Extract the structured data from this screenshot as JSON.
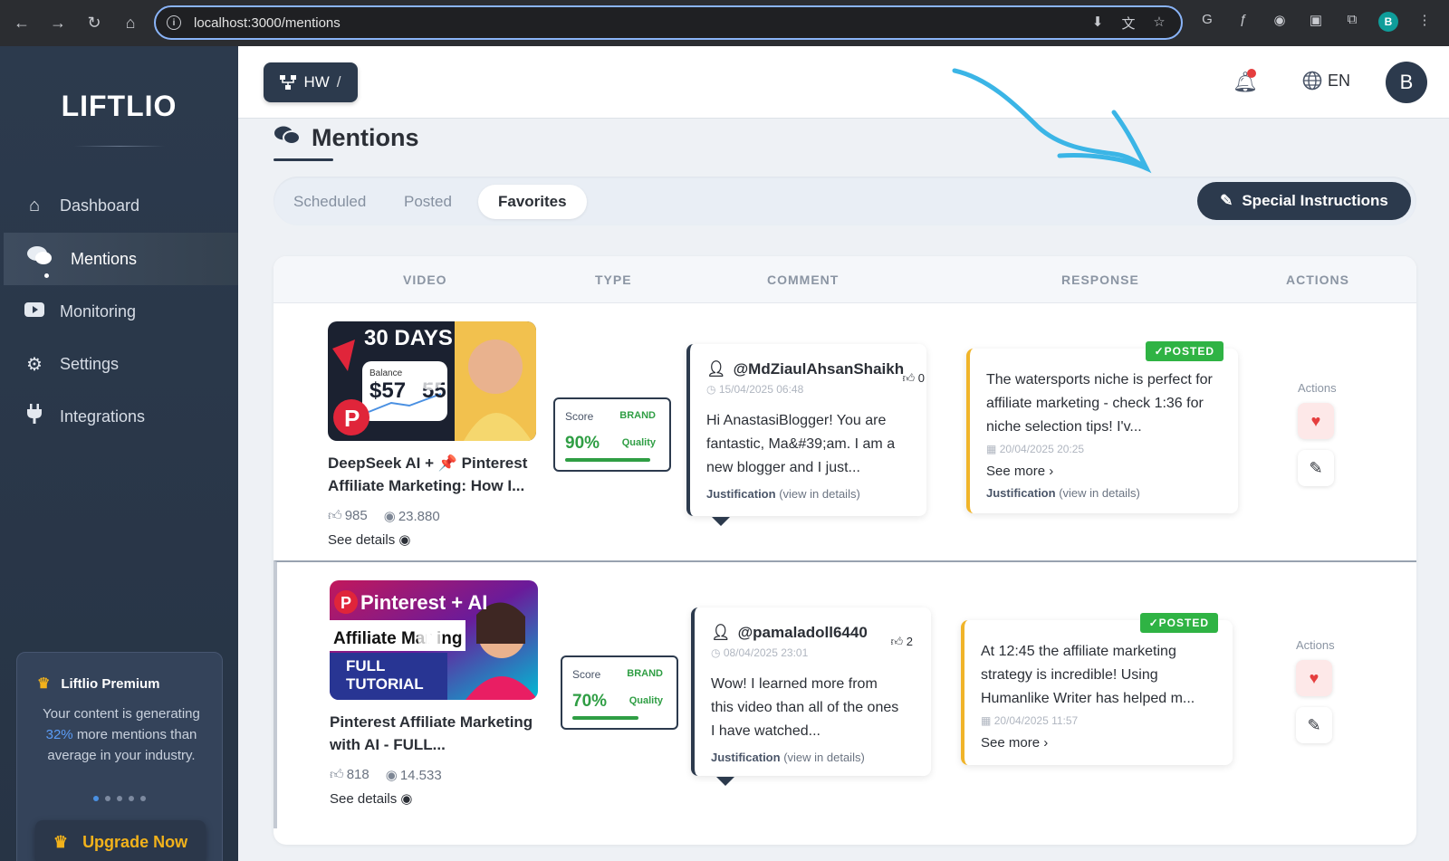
{
  "browser": {
    "url": "localhost:3000/mentions",
    "profile_initial": "B"
  },
  "sidebar": {
    "logo": "LIFTLIO",
    "items": [
      {
        "label": "Dashboard",
        "icon": "home-icon"
      },
      {
        "label": "Mentions",
        "icon": "comments-icon"
      },
      {
        "label": "Monitoring",
        "icon": "youtube-icon"
      },
      {
        "label": "Settings",
        "icon": "gear-icon"
      },
      {
        "label": "Integrations",
        "icon": "plug-icon"
      }
    ],
    "active": "Mentions",
    "premium": {
      "title": "Liftlio Premium",
      "text_before": "Your content is generating",
      "percent": "32%",
      "text_after": "more mentions than average in your industry.",
      "upgrade_label": "Upgrade Now"
    }
  },
  "header": {
    "project_label": "HW",
    "language": "EN",
    "avatar_initial": "B"
  },
  "page": {
    "title": "Mentions",
    "tabs": [
      "Scheduled",
      "Posted",
      "Favorites"
    ],
    "active_tab": "Favorites",
    "special_instructions_label": "Special Instructions"
  },
  "table": {
    "columns": [
      "VIDEO",
      "TYPE",
      "COMMENT",
      "RESPONSE",
      "ACTIONS"
    ],
    "rows": [
      {
        "video": {
          "thumb_title": "30 DAYS",
          "thumb_balance_label": "Balance",
          "thumb_amount": "$57",
          "thumb_amount_end": "55",
          "title": "DeepSeek AI + 📌 Pinterest Affiliate Marketing: How I...",
          "likes": "985",
          "views": "23.880",
          "details_label": "See details"
        },
        "type": {
          "score_label": "Score",
          "brand": "BRAND",
          "score": "90%",
          "quality": "Quality",
          "fill": 0.9
        },
        "comment": {
          "author": "@MdZiaulAhsanShaikh",
          "likes": "0",
          "date": "15/04/2025 06:48",
          "text": "Hi AnastasiBlogger! You are fantastic, Ma&#39;am. I am a new blogger and I just...",
          "justification": "Justification",
          "view_details": "(view in details)"
        },
        "response": {
          "status": "POSTED",
          "text": "The watersports niche is perfect for affiliate marketing - check 1:36 for niche selection tips! I'v...",
          "date": "20/04/2025 20:25",
          "see_more": "See more",
          "justification": "Justification",
          "view_details": "(view in details)"
        },
        "actions_label": "Actions"
      },
      {
        "video": {
          "thumb_title": "Pinterest + AI",
          "thumb_sub": "Affiliate Mar",
          "thumb_sub_end": "ing",
          "thumb_full": "FULL",
          "thumb_tutorial": "TUTORIAL",
          "title": "Pinterest Affiliate Marketing with AI - FULL...",
          "likes": "818",
          "views": "14.533",
          "details_label": "See details"
        },
        "type": {
          "score_label": "Score",
          "brand": "BRAND",
          "score": "70%",
          "quality": "Quality",
          "fill": 0.7
        },
        "comment": {
          "author": "@pamaladoll6440",
          "likes": "2",
          "date": "08/04/2025 23:01",
          "text": "Wow! I learned more from this video than all of the ones I have watched...",
          "justification": "Justification",
          "view_details": "(view in details)"
        },
        "response": {
          "status": "POSTED",
          "text": "At 12:45 the affiliate marketing strategy is incredible! Using Humanlike Writer has helped m...",
          "date": "20/04/2025 11:57",
          "see_more": "See more"
        },
        "actions_label": "Actions"
      }
    ]
  },
  "colors": {
    "sidebar_bg": "#2c3a4d",
    "accent_green": "#2f9e44",
    "posted_green": "#2fb344",
    "response_border": "#f0b429",
    "annotation_arrow": "#3bb5e6"
  }
}
